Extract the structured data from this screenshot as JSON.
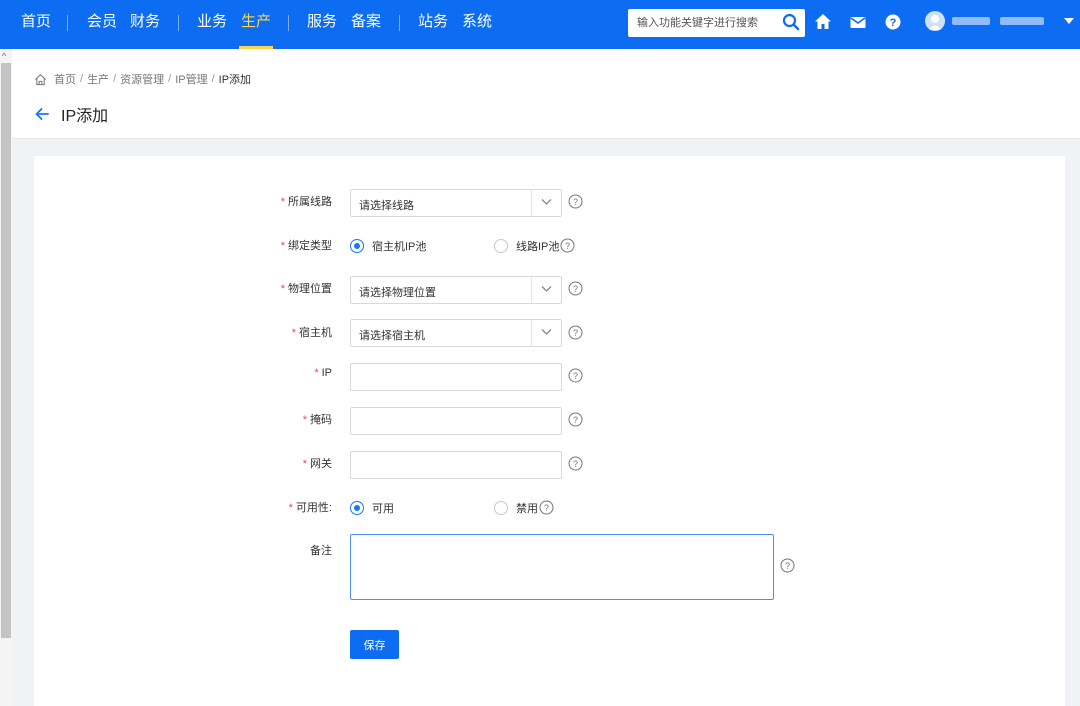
{
  "nav": {
    "items": [
      "首页",
      "会员",
      "财务",
      "业务",
      "生产",
      "服务",
      "备案",
      "站务",
      "系统"
    ],
    "active": "生产",
    "search_placeholder": "输入功能关键字进行搜索"
  },
  "breadcrumb": [
    "首页",
    "生产",
    "资源管理",
    "IP管理",
    "IP添加"
  ],
  "page_title": "IP添加",
  "form": {
    "line": {
      "label": "所属线路",
      "placeholder": "请选择线路"
    },
    "bind_type": {
      "label": "绑定类型",
      "options": [
        "宿主机IP池",
        "线路IP池"
      ],
      "selected": "宿主机IP池"
    },
    "location": {
      "label": "物理位置",
      "placeholder": "请选择物理位置"
    },
    "host": {
      "label": "宿主机",
      "placeholder": "请选择宿主机"
    },
    "ip": {
      "label": "IP",
      "value": ""
    },
    "mask": {
      "label": "掩码",
      "value": ""
    },
    "gateway": {
      "label": "网关",
      "value": ""
    },
    "availability": {
      "label": "可用性:",
      "options": [
        "可用",
        "禁用"
      ],
      "selected": "可用"
    },
    "note": {
      "label": "备注",
      "value": ""
    },
    "required_mark": "*",
    "save_label": "保存"
  },
  "colors": {
    "primary": "#0c6cf2",
    "nav_active": "#ffd24d",
    "required": "#e24c4c"
  }
}
